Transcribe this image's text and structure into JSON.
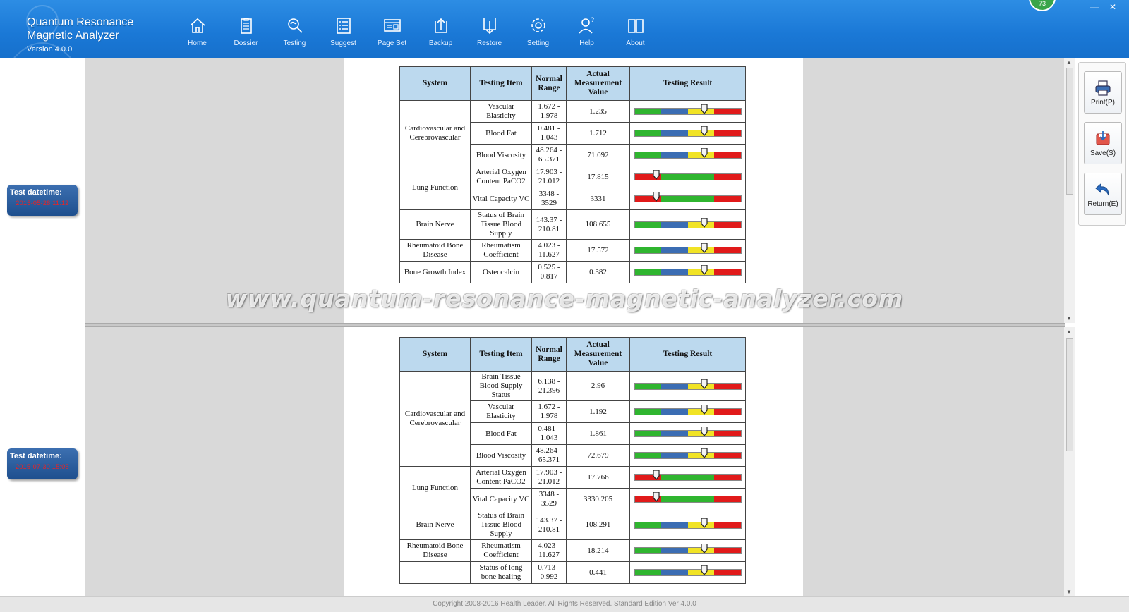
{
  "app": {
    "title_line1": "Quantum Resonance",
    "title_line2": "Magnetic Analyzer",
    "version": "Version 4.0.0",
    "badge": "73"
  },
  "nav": [
    {
      "label": "Home",
      "icon": "home-icon"
    },
    {
      "label": "Dossier",
      "icon": "clipboard-icon"
    },
    {
      "label": "Testing",
      "icon": "magnifier-icon"
    },
    {
      "label": "Suggest",
      "icon": "list-icon"
    },
    {
      "label": "Page Set",
      "icon": "page-layout-icon"
    },
    {
      "label": "Backup",
      "icon": "upload-icon"
    },
    {
      "label": "Restore",
      "icon": "download-icon"
    },
    {
      "label": "Setting",
      "icon": "gear-icon"
    },
    {
      "label": "Help",
      "icon": "help-person-icon"
    },
    {
      "label": "About",
      "icon": "book-icon"
    }
  ],
  "actions": {
    "print": "Print(P)",
    "save": "Save(S)",
    "return": "Return(E)"
  },
  "tests": [
    {
      "label": "Test datetime:",
      "value": "2015-05-28 11:12"
    },
    {
      "label": "Test datetime:",
      "value": "2015-07-30 15:05"
    }
  ],
  "columns": [
    "System",
    "Testing Item",
    "Normal Range",
    "Actual Measurement Value",
    "Testing Result"
  ],
  "report_top": [
    {
      "system": "Cardiovascular and Cerebrovascular",
      "rowspan": 3,
      "item": "Vascular Elasticity",
      "range": "1.672 - 1.978",
      "value": "1.235",
      "gauge": "normal",
      "level": 0.62
    },
    {
      "item": "Blood Fat",
      "range": "0.481 - 1.043",
      "value": "1.712",
      "gauge": "normal",
      "level": 0.62
    },
    {
      "item": "Blood Viscosity",
      "range": "48.264 - 65.371",
      "value": "71.092",
      "gauge": "normal",
      "level": 0.62
    },
    {
      "system": "Lung Function",
      "rowspan": 2,
      "item": "Arterial Oxygen Content PaCO2",
      "range": "17.903 - 21.012",
      "value": "17.815",
      "gauge": "lung",
      "level": 0.17
    },
    {
      "item": "Vital Capacity VC",
      "range": "3348 - 3529",
      "value": "3331",
      "gauge": "lung",
      "level": 0.17
    },
    {
      "system": "Brain Nerve",
      "rowspan": 1,
      "item": "Status of Brain Tissue Blood Supply",
      "range": "143.37 - 210.81",
      "value": "108.655",
      "gauge": "normal",
      "level": 0.62
    },
    {
      "system": "Rheumatoid Bone Disease",
      "rowspan": 1,
      "item": "Rheumatism Coefficient",
      "range": "4.023 - 11.627",
      "value": "17.572",
      "gauge": "normal",
      "level": 0.62
    },
    {
      "system": "Bone Growth Index",
      "rowspan": 1,
      "item": "Osteocalcin",
      "range": "0.525 - 0.817",
      "value": "0.382",
      "gauge": "normal",
      "level": 0.62
    }
  ],
  "report_bottom": [
    {
      "system": "Cardiovascular and Cerebrovascular",
      "rowspan": 4,
      "item": "Brain Tissue Blood Supply Status",
      "range": "6.138 - 21.396",
      "value": "2.96",
      "gauge": "normal",
      "level": 0.62
    },
    {
      "item": "Vascular Elasticity",
      "range": "1.672 - 1.978",
      "value": "1.192",
      "gauge": "normal",
      "level": 0.62
    },
    {
      "item": "Blood Fat",
      "range": "0.481 - 1.043",
      "value": "1.861",
      "gauge": "normal",
      "level": 0.62
    },
    {
      "item": "Blood Viscosity",
      "range": "48.264 - 65.371",
      "value": "72.679",
      "gauge": "normal",
      "level": 0.62
    },
    {
      "system": "Lung Function",
      "rowspan": 2,
      "item": "Arterial Oxygen Content PaCO2",
      "range": "17.903 - 21.012",
      "value": "17.766",
      "gauge": "lung",
      "level": 0.17
    },
    {
      "item": "Vital Capacity VC",
      "range": "3348 - 3529",
      "value": "3330.205",
      "gauge": "lung",
      "level": 0.17
    },
    {
      "system": "Brain Nerve",
      "rowspan": 1,
      "item": "Status of Brain Tissue Blood Supply",
      "range": "143.37 - 210.81",
      "value": "108.291",
      "gauge": "normal",
      "level": 0.62
    },
    {
      "system": "Rheumatoid Bone Disease",
      "rowspan": 1,
      "item": "Rheumatism Coefficient",
      "range": "4.023 - 11.627",
      "value": "18.214",
      "gauge": "normal",
      "level": 0.62
    },
    {
      "system": "",
      "rowspan": 1,
      "item": "Status of long bone healing",
      "range": "0.713 - 0.992",
      "value": "0.441",
      "gauge": "normal",
      "level": 0.62
    }
  ],
  "watermark": "www.quantum-resonance-magnetic-analyzer.com",
  "footer": "Copyright 2008-2016 Health Leader. All Rights Reserved.  Standard Edition Ver 4.0.0",
  "colors": {
    "header": "#1a78d6",
    "table_header": "#bcd9ee",
    "green": "#2fb52f",
    "blue": "#3b6db3",
    "yellow": "#f1e325",
    "red": "#e11a1a"
  }
}
